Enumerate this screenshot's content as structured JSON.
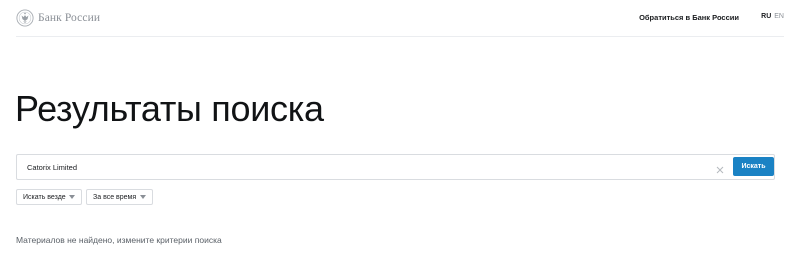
{
  "header": {
    "logo_text": "Банк России",
    "logo_icon": "bank-emblem-icon",
    "contact_link": "Обратиться в Банк России",
    "lang_ru": "RU",
    "lang_en": "EN"
  },
  "main": {
    "title": "Результаты поиска",
    "search": {
      "value": "Catorix Limited",
      "clear_icon": "close-icon",
      "button_label": "Искать"
    },
    "filters": {
      "where": {
        "selected": "Искать везде",
        "icon": "chevron-down-icon"
      },
      "time": {
        "selected": "За все время",
        "icon": "chevron-down-icon"
      }
    },
    "empty_message": "Материалов не найдено, измените критерии поиска"
  },
  "colors": {
    "accent": "#1a82c4",
    "text": "#1b1d20",
    "muted": "#8a8f96",
    "border": "#d9dce0"
  }
}
